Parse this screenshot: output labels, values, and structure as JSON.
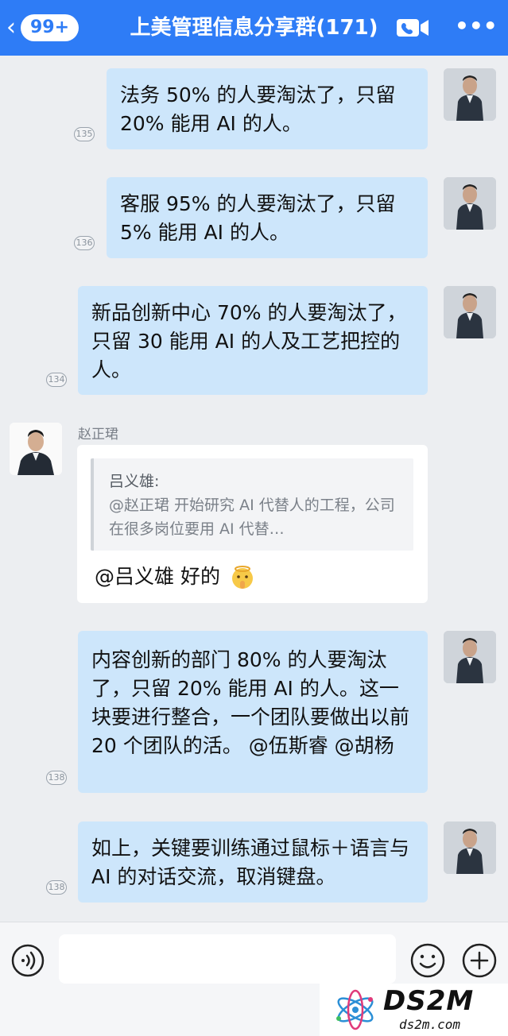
{
  "header": {
    "back_badge": "99+",
    "title": "上美管理信息分享群(171)"
  },
  "messages": [
    {
      "text": "法务 50% 的人要淘汰了，只留 20% 能用 AI 的人。",
      "read_count": "135"
    },
    {
      "text": "客服 95% 的人要淘汰了，只留 5% 能用 AI 的人。",
      "read_count": "136"
    },
    {
      "text": "新品创新中心 70% 的人要淘汰了，只留 30 能用 AI 的人及工艺把控的人。",
      "read_count": "134"
    },
    {
      "text": "内容创新的部门 80% 的人要淘汰了，只留 20% 能用 AI 的人。这一块要进行整合，一个团队要做出以前 20 个团队的活。 @伍斯睿 @胡杨",
      "read_count": "138"
    },
    {
      "text": "如上，关键要训练通过鼠标＋语言与 AI 的对话交流，取消键盘。",
      "read_count": "138"
    }
  ],
  "reply_message": {
    "sender": "赵正珺",
    "quote_author": "吕义雄:",
    "quote_text": "@赵正珺 开始研究 AI 代替人的工程，公司在很多岗位要用 AI 代替…",
    "text": "@吕义雄 好的"
  },
  "watermark": {
    "main": "DS2M",
    "sub": "ds2m.com"
  },
  "colors": {
    "header": "#2e7cf6",
    "self_bubble": "#cde6fb",
    "background": "#eceef1"
  }
}
